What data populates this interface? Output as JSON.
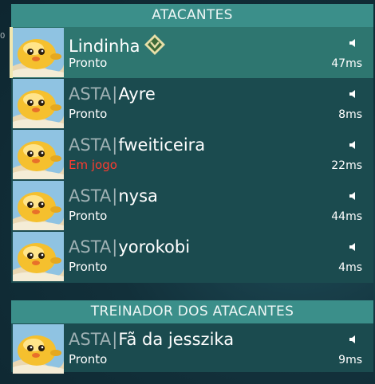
{
  "edge_marker": "0",
  "attackers": {
    "title": "ATACANTES",
    "players": [
      {
        "tag": "",
        "name": "Lindinha",
        "status": "Pronto",
        "ping": "47ms",
        "in_game": false,
        "badge": true
      },
      {
        "tag": "ASTA",
        "name": "Ayre",
        "status": "Pronto",
        "ping": "8ms",
        "in_game": false,
        "badge": false
      },
      {
        "tag": "ASTA",
        "name": "fweiticeira",
        "status": "Em jogo",
        "ping": "22ms",
        "in_game": true,
        "badge": false
      },
      {
        "tag": "ASTA",
        "name": "nysa",
        "status": "Pronto",
        "ping": "44ms",
        "in_game": false,
        "badge": false
      },
      {
        "tag": "ASTA",
        "name": "yorokobi",
        "status": "Pronto",
        "ping": "4ms",
        "in_game": false,
        "badge": false
      }
    ]
  },
  "coach": {
    "title": "TREINADOR DOS ATACANTES",
    "player": {
      "tag": "ASTA",
      "name": "Fã da jesszika",
      "status": "Pronto",
      "ping": "9ms"
    }
  },
  "tag_separator": "|",
  "colors": {
    "header": "#3b8f8a",
    "panel": "#1b4b4f",
    "highlight_row": "#2e7670",
    "in_game_status": "#ff3b2f",
    "tag": "#9fb1b4"
  },
  "icons": {
    "avatar": "yellow-bird-avatar-icon",
    "speaker": "speaker-icon",
    "rank": "rank-badge-icon"
  }
}
